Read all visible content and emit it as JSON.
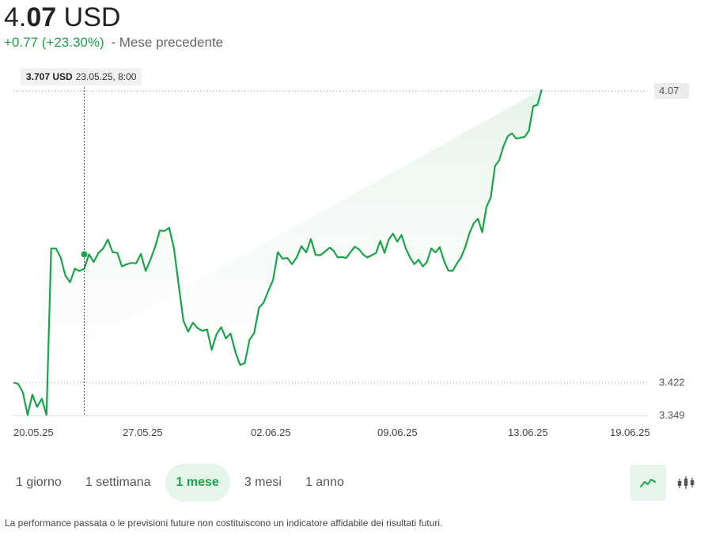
{
  "header": {
    "price_int": "4.",
    "price_dec": "07",
    "currency": "USD",
    "change": "+0.77 (+23.30%)",
    "period": "- Mese precedente"
  },
  "tooltip": {
    "value": "3.707 USD",
    "datetime": "23.05.25, 8:00"
  },
  "chart_data": {
    "type": "area",
    "title": "",
    "xlabel": "",
    "ylabel": "",
    "ylim": [
      3.349,
      4.07
    ],
    "y_ticks": [
      "3.349",
      "3.422",
      "4.07"
    ],
    "x_ticks": [
      "20.05.25",
      "27.05.25",
      "02.06.25",
      "09.06.25",
      "13.06.25",
      "19.06.25"
    ],
    "x": [
      0,
      1,
      2,
      3,
      4,
      5,
      6,
      7,
      8,
      9,
      10,
      11,
      12,
      13,
      14,
      15,
      16,
      17,
      18,
      19,
      20,
      21,
      22,
      23,
      24,
      25,
      26,
      27,
      28,
      29,
      30,
      31,
      32,
      33,
      34,
      35,
      36,
      37,
      38,
      39,
      40,
      41,
      42,
      43,
      44,
      45,
      46,
      47,
      48,
      49,
      50,
      51,
      52,
      53,
      54,
      55,
      56,
      57,
      58,
      59,
      60,
      61,
      62,
      63,
      64,
      65,
      66,
      67,
      67.8,
      68.7,
      69.6,
      70.5,
      71.4,
      72.3,
      73.2,
      74.1,
      75,
      75.9,
      76.8,
      77.7,
      78.6,
      79.5,
      80.4,
      81.3,
      82.2,
      83.1,
      84,
      84.9,
      85.8,
      86.7,
      87.6,
      88.5,
      89.4,
      90.3,
      91.2,
      92.1,
      93,
      93.9,
      94.8,
      95.7,
      96.6,
      97.5,
      98.4,
      99.3,
      100.2,
      101.1,
      102,
      102.9,
      103.8,
      104.7,
      105.6,
      106.5,
      107.4,
      108.3,
      109.2,
      110.1,
      111,
      111.9,
      112.8,
      113.7,
      114.6,
      115.5,
      116.4,
      117.3,
      118.2,
      119.1,
      120,
      120.9,
      121.8,
      122.7,
      123.6,
      124.5,
      125.4,
      126.3,
      127.2,
      128.1,
      129,
      129.9,
      130.8,
      131.7,
      132.6,
      133.5,
      134.4
    ],
    "y": [
      3.422,
      3.419,
      3.4,
      3.35,
      3.395,
      3.368,
      3.386,
      3.35,
      3.72,
      3.72,
      3.7,
      3.66,
      3.645,
      3.675,
      3.67,
      3.675,
      3.707,
      3.69,
      3.71,
      3.72,
      3.74,
      3.712,
      3.71,
      3.68,
      3.685,
      3.688,
      3.687,
      3.708,
      3.67,
      3.695,
      3.723,
      3.76,
      3.759,
      3.766,
      3.72,
      3.638,
      3.56,
      3.535,
      3.555,
      3.543,
      3.537,
      3.54,
      3.495,
      3.529,
      3.545,
      3.52,
      3.531,
      3.49,
      3.461,
      3.465,
      3.517,
      3.532,
      3.588,
      3.6,
      3.626,
      3.65,
      3.712,
      3.697,
      3.699,
      3.685,
      3.7,
      3.725,
      3.711,
      3.741,
      3.706,
      3.705,
      3.713,
      3.722,
      3.715,
      3.7,
      3.701,
      3.699,
      3.712,
      3.724,
      3.718,
      3.706,
      3.7,
      3.705,
      3.71,
      3.737,
      3.71,
      3.74,
      3.753,
      3.735,
      3.75,
      3.72,
      3.7,
      3.685,
      3.695,
      3.68,
      3.69,
      3.72,
      3.711,
      3.723,
      3.693,
      3.671,
      3.67,
      3.686,
      3.7,
      3.723,
      3.754,
      3.776,
      3.786,
      3.756,
      3.812,
      3.833,
      3.903,
      3.916,
      3.947,
      3.969,
      3.976,
      3.964,
      3.966,
      3.968,
      3.982,
      4.036,
      4.039,
      4.073
    ],
    "line_color": "#1aa34a",
    "fill_color": "#e6f4ea",
    "grid": false,
    "crosshair_x": 15,
    "crosshair_y": 3.707
  },
  "ranges": [
    "1 giorno",
    "1 settimana",
    "1 mese",
    "3 mesi",
    "1 anno"
  ],
  "active_range": 2,
  "disclaimer": "La performance passata o le previsioni future non costituiscono un indicatore affidabile dei risultati futuri."
}
